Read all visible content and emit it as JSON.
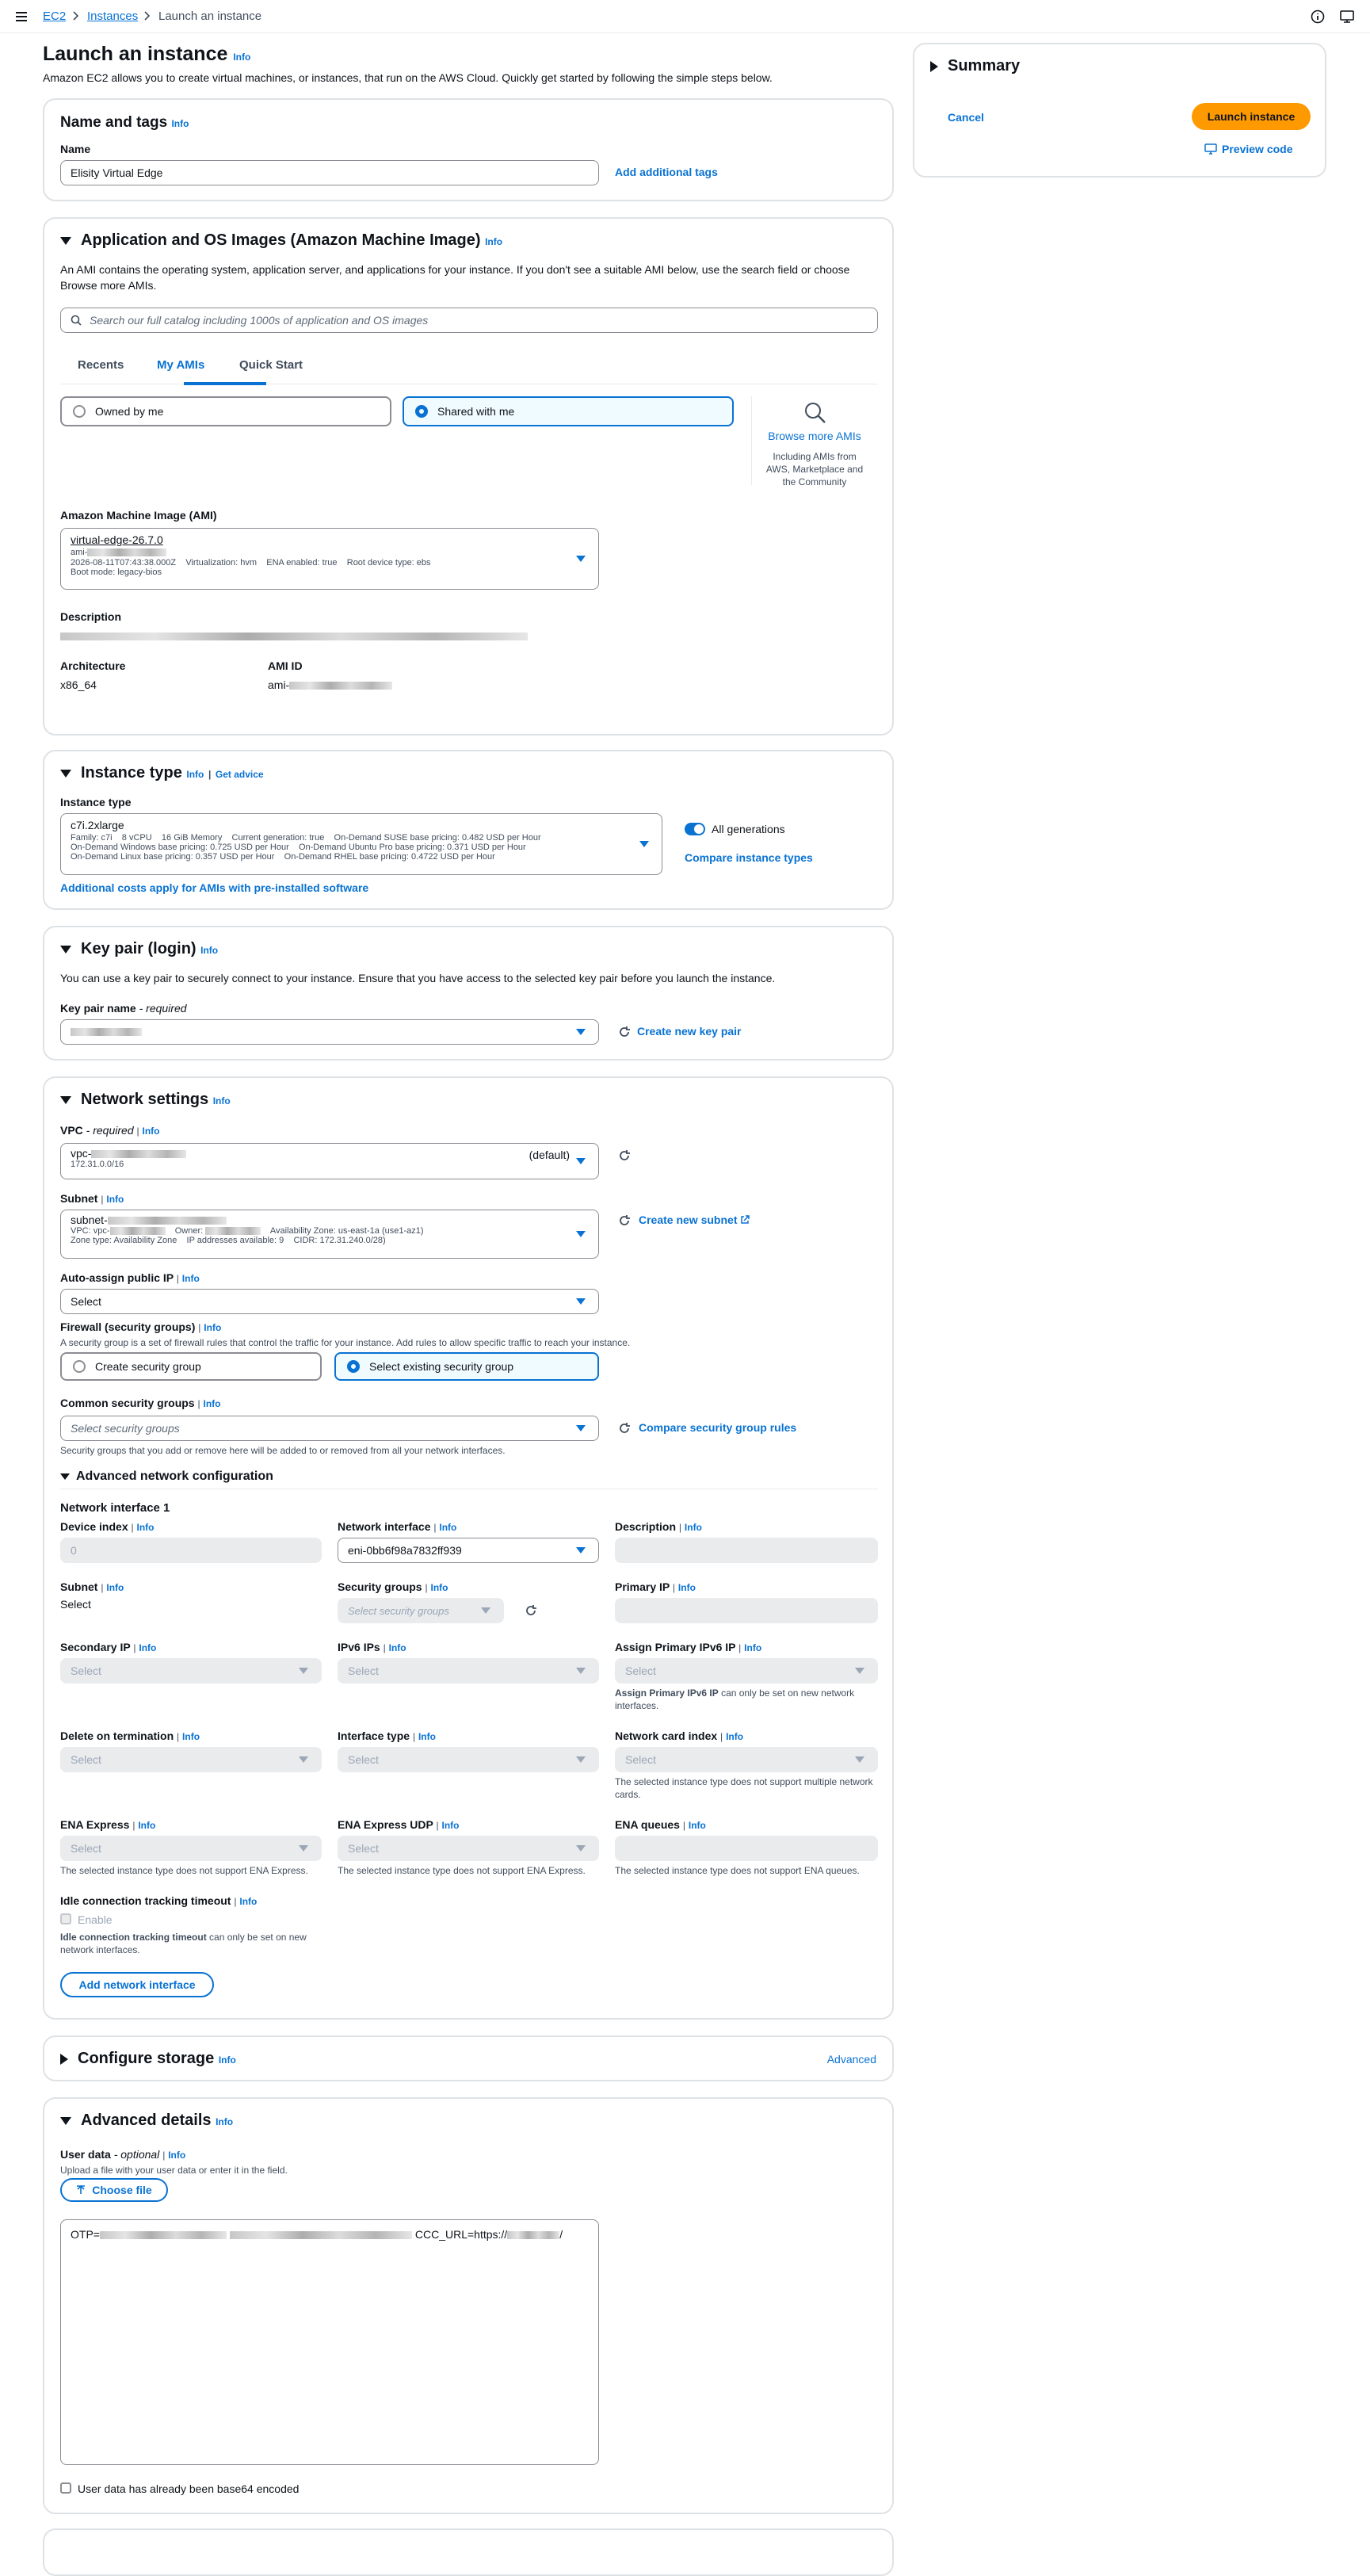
{
  "breadcrumb": {
    "ec2": "EC2",
    "instances": "Instances",
    "current": "Launch an instance"
  },
  "page": {
    "title": "Launch an instance",
    "info": "Info",
    "description": "Amazon EC2 allows you to create virtual machines, or instances, that run on the AWS Cloud. Quickly get started by following the simple steps below."
  },
  "name_tags": {
    "title": "Name and tags",
    "info": "Info",
    "name_label": "Name",
    "name_value": "Elisity Virtual Edge",
    "add_tags": "Add additional tags"
  },
  "ami": {
    "title": "Application and OS Images (Amazon Machine Image)",
    "info": "Info",
    "description": "An AMI contains the operating system, application server, and applications for your instance. If you don't see a suitable AMI below, use the search field or choose Browse more AMIs.",
    "search_placeholder": "Search our full catalog including 1000s of application and OS images",
    "tabs": [
      "Recents",
      "My AMIs",
      "Quick Start"
    ],
    "owned_by_me": "Owned by me",
    "shared_with_me": "Shared with me",
    "browse_more": "Browse more AMIs",
    "browse_sub": "Including AMIs from AWS, Marketplace and the Community",
    "ami_label": "Amazon Machine Image (AMI)",
    "ami_name": "virtual-edge-26.7.0",
    "ami_id_prefix": "ami-",
    "ami_details": "2026-08-11T07:43:38.000Z    Virtualization: hvm    ENA enabled: true    Root device type: ebs",
    "boot_mode": "Boot mode: legacy-bios",
    "desc_label": "Description",
    "arch_label": "Architecture",
    "arch_value": "x86_64",
    "amiid_label": "AMI ID",
    "amiid_prefix": "ami-"
  },
  "instance_type": {
    "title": "Instance type",
    "info": "Info",
    "get_advice": "Get advice",
    "label": "Instance type",
    "name": "c7i.2xlarge",
    "line1": "Family: c7i    8 vCPU    16 GiB Memory    Current generation: true    On-Demand SUSE base pricing: 0.482 USD per Hour",
    "line2": "On-Demand Windows base pricing: 0.725 USD per Hour    On-Demand Ubuntu Pro base pricing: 0.371 USD per Hour",
    "line3": "On-Demand Linux base pricing: 0.357 USD per Hour    On-Demand RHEL base pricing: 0.4722 USD per Hour",
    "all_generations": "All generations",
    "compare": "Compare instance types",
    "additional_costs": "Additional costs apply for AMIs with pre-installed software"
  },
  "key_pair": {
    "title": "Key pair (login)",
    "info": "Info",
    "description": "You can use a key pair to securely connect to your instance. Ensure that you have access to the selected key pair before you launch the instance.",
    "label": "Key pair name",
    "required": " - required",
    "create": "Create new key pair"
  },
  "network": {
    "title": "Network settings",
    "info": "Info",
    "vpc_label": "VPC",
    "required": " - required",
    "vpc_prefix": "vpc-",
    "vpc_default": "(default)",
    "vpc_cidr": "172.31.0.0/16",
    "subnet_label": "Subnet",
    "subnet_prefix": "subnet-",
    "subnet_line1a": "VPC: vpc-",
    "subnet_line1b": "Owner:",
    "subnet_line1c": "Availability Zone: us-east-1a (use1-az1)",
    "subnet_line2": "Zone type: Availability Zone    IP addresses available: 9    CIDR: 172.31.240.0/28)",
    "create_subnet": "Create new subnet",
    "auto_ip_label": "Auto-assign public IP",
    "select": "Select",
    "firewall_label": "Firewall (security groups)",
    "firewall_desc": "A security group is a set of firewall rules that control the traffic for your instance. Add rules to allow specific traffic to reach your instance.",
    "create_sg": "Create security group",
    "select_sg": "Select existing security group",
    "common_sg_label": "Common security groups",
    "common_sg_placeholder": "Select security groups",
    "compare_sg": "Compare security group rules",
    "common_sg_help": "Security groups that you add or remove here will be added to or removed from all your network interfaces.",
    "adv_title": "Advanced network configuration",
    "ni_title": "Network interface 1",
    "device_index": "Device index",
    "device_index_val": "0",
    "net_iface": "Network interface",
    "net_iface_val": "eni-0bb6f98a7832ff939",
    "description": "Description",
    "subnet": "Subnet",
    "subnet_val": "Select",
    "security_groups": "Security groups",
    "sg_placeholder": "Select security groups",
    "primary_ip": "Primary IP",
    "secondary_ip": "Secondary IP",
    "ipv6": "IPv6 IPs",
    "assign_ipv6": "Assign Primary IPv6 IP",
    "assign_ipv6_help_b": "Assign Primary IPv6 IP",
    "assign_ipv6_help": " can only be set on new network interfaces.",
    "delete_term": "Delete on termination",
    "iface_type": "Interface type",
    "net_card": "Network card index",
    "net_card_help": "The selected instance type does not support multiple network cards.",
    "ena_express": "ENA Express",
    "ena_express_help": "The selected instance type does not support ENA Express.",
    "ena_udp": "ENA Express UDP",
    "ena_udp_help": "The selected instance type does not support ENA Express.",
    "ena_queues": "ENA queues",
    "ena_queues_help": "The selected instance type does not support ENA queues.",
    "idle": "Idle connection tracking timeout",
    "enable": "Enable",
    "idle_help_b": "Idle connection tracking timeout",
    "idle_help": " can only be set on new network interfaces.",
    "add_ni": "Add network interface"
  },
  "storage": {
    "title": "Configure storage",
    "info": "Info",
    "advanced": "Advanced"
  },
  "advanced": {
    "title": "Advanced details",
    "info": "Info",
    "user_data_label": "User data",
    "optional": " - optional",
    "user_data_help": "Upload a file with your user data or enter it in the field.",
    "choose_file": "Choose file",
    "user_data_prefix": "OTP=",
    "user_data_mid": "CCC_URL=https://",
    "user_data_end": "/",
    "base64": "User data has already been base64 encoded"
  },
  "summary": {
    "title": "Summary",
    "cancel": "Cancel",
    "launch": "Launch instance",
    "preview": "Preview code"
  },
  "colors": {
    "accent": "#0972d3",
    "primary_button": "#ff9900",
    "border": "#dfe2e5"
  }
}
